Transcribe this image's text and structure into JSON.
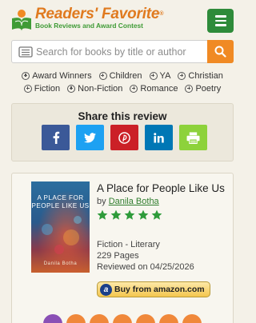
{
  "header": {
    "brand": "Readers' Favorite",
    "brand_mark": "®",
    "tagline": "Book Reviews and Award Contest",
    "menu_icon": "hamburger-menu-icon"
  },
  "search": {
    "placeholder": "Search for books by title or author",
    "book_icon": "book-icon",
    "button_icon": "search-icon"
  },
  "categories": {
    "row1": [
      "Award Winners",
      "Children",
      "YA",
      "Christian"
    ],
    "row2": [
      "Fiction",
      "Non-Fiction",
      "Romance",
      "Poetry"
    ]
  },
  "share": {
    "title": "Share this review",
    "buttons": [
      {
        "name": "facebook",
        "icon": "facebook-icon",
        "color": "#3b5998"
      },
      {
        "name": "twitter",
        "icon": "twitter-icon",
        "color": "#1da1f2"
      },
      {
        "name": "pinterest",
        "icon": "pinterest-icon",
        "color": "#cb2027"
      },
      {
        "name": "linkedin",
        "icon": "linkedin-icon",
        "color": "#0077b5"
      },
      {
        "name": "print",
        "icon": "printer-icon",
        "color": "#8dd23b"
      }
    ]
  },
  "book": {
    "cover_title": "A PLACE FOR PEOPLE LIKE US",
    "cover_author": "Danila Botha",
    "title": "A Place for People Like Us",
    "by_label": "by",
    "author": "Danila Botha",
    "rating": 5,
    "genre": "Fiction - Literary",
    "pages": "229 Pages",
    "reviewed": "Reviewed on 04/25/2026",
    "buy_label": "Buy from",
    "buy_store": "amazon.com"
  },
  "colors": {
    "accent_orange": "#f08a24",
    "brand_green": "#2e8b3a",
    "star_green": "#2e9b3a"
  },
  "bottom_icons": [
    {
      "icon": "book-icon",
      "color": "#8a4fb5"
    },
    {
      "icon": "question-icon",
      "color": "#f0883a"
    },
    {
      "icon": "facebook-icon",
      "color": "#f0883a"
    },
    {
      "icon": "twitter-icon",
      "color": "#f0883a"
    },
    {
      "icon": "pinterest-icon",
      "color": "#f0883a"
    },
    {
      "icon": "instagram-icon",
      "color": "#f0883a"
    },
    {
      "icon": "linkedin-icon",
      "color": "#f0883a"
    }
  ]
}
